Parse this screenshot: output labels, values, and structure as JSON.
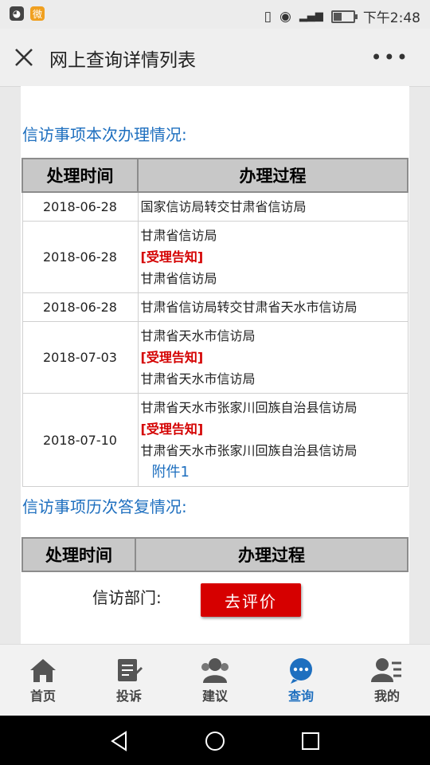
{
  "status_bar": {
    "time": "下午2:48",
    "app_icons": [
      "cat-icon",
      "weibo-icon"
    ]
  },
  "title_bar": {
    "title": "网上查询详情列表"
  },
  "section1": {
    "title": "信访事项本次办理情况:",
    "headers": [
      "处理时间",
      "办理过程"
    ],
    "rows": [
      {
        "date": "2018-06-28",
        "lines": [
          "国家信访局转交甘肃省信访局"
        ]
      },
      {
        "date": "2018-06-28",
        "lines": [
          "甘肃省信访局"
        ],
        "tag": "[受理告知]",
        "after": "甘肃省信访局"
      },
      {
        "date": "2018-06-28",
        "lines": [
          "甘肃省信访局转交甘肃省天水市信访局"
        ]
      },
      {
        "date": "2018-07-03",
        "lines": [
          "甘肃省天水市信访局"
        ],
        "tag": "[受理告知]",
        "after": "甘肃省天水市信访局"
      },
      {
        "date": "2018-07-10",
        "lines": [
          "甘肃省天水市张家川回族自治县信访局"
        ],
        "tag": "[受理告知]",
        "after": "甘肃省天水市张家川回族自治县信访局",
        "link": "附件1"
      }
    ]
  },
  "section2": {
    "title": "信访事项历次答复情况:",
    "headers": [
      "处理时间",
      "办理过程"
    ],
    "dept_label": "信访部门:",
    "rate_button": "去评价"
  },
  "tab_bar": {
    "tabs": [
      {
        "label": "首页",
        "icon": "home-icon"
      },
      {
        "label": "投诉",
        "icon": "complaint-icon"
      },
      {
        "label": "建议",
        "icon": "suggestion-icon"
      },
      {
        "label": "查询",
        "icon": "query-icon",
        "active": true
      },
      {
        "label": "我的",
        "icon": "profile-icon"
      }
    ]
  },
  "colors": {
    "accent": "#1e6fbf",
    "tag_red": "#d40000",
    "button_red": "#d60000"
  }
}
